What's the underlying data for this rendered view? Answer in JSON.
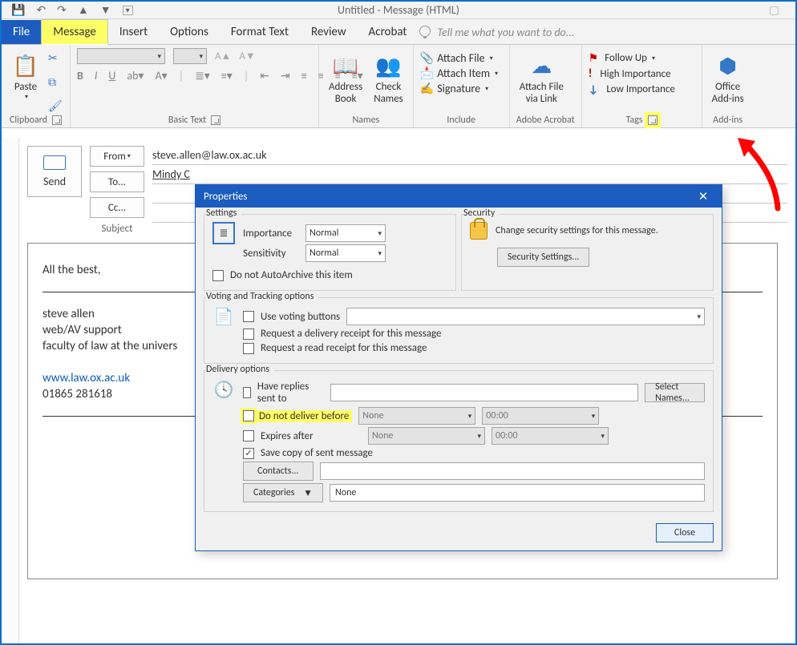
{
  "window": {
    "title": "Untitled - Message (HTML)"
  },
  "qat": {
    "save": "💾",
    "undo": "↶",
    "redo": "↷"
  },
  "tabs": {
    "file": "File",
    "message": "Message",
    "insert": "Insert",
    "options": "Options",
    "format_text": "Format Text",
    "review": "Review",
    "acrobat": "Acrobat",
    "tellme": "Tell me what you want to do..."
  },
  "ribbon": {
    "clipboard": {
      "paste": "Paste",
      "label": "Clipboard"
    },
    "basic_text": {
      "bold": "B",
      "italic": "I",
      "underline": "U",
      "label": "Basic Text"
    },
    "names": {
      "address": "Address",
      "book": "Book",
      "check": "Check",
      "names_line": "Names",
      "label": "Names"
    },
    "include": {
      "attach_file": "Attach File",
      "attach_item": "Attach Item",
      "signature": "Signature",
      "label": "Include"
    },
    "adobe": {
      "line1": "Attach File",
      "line2": "via Link",
      "label": "Adobe Acrobat"
    },
    "tags": {
      "followup": "Follow Up",
      "high": "High Importance",
      "low": "Low Importance",
      "label": "Tags"
    },
    "addins": {
      "line1": "Office",
      "line2": "Add-ins",
      "label": "Add-ins"
    }
  },
  "compose": {
    "from_label": "From",
    "to_label": "To...",
    "cc_label": "Cc...",
    "subject_label": "Subject",
    "send": "Send",
    "from_value": "steve.allen@law.ox.ac.uk",
    "to_value": "Mindy C",
    "body": {
      "l1": "All the best,",
      "l2": "steve allen",
      "l3": "web/AV support",
      "l4": "faculty of law at the univers",
      "l5": "www.law.ox.ac.uk",
      "l6": "01865 281618"
    }
  },
  "dialog": {
    "title": "Properties",
    "settings_legend": "Settings",
    "security_legend": "Security",
    "importance_label": "Importance",
    "importance_value": "Normal",
    "sensitivity_label": "Sensitivity",
    "sensitivity_value": "Normal",
    "autoarchive": "Do not AutoArchive this item",
    "security_text": "Change security settings for this message.",
    "security_btn": "Security Settings...",
    "voting_legend": "Voting and Tracking options",
    "voting": "Use voting buttons",
    "delivery_receipt": "Request a delivery receipt for this message",
    "read_receipt": "Request a read receipt for this message",
    "delivery_legend": "Delivery options",
    "have_replies": "Have replies sent to",
    "select_names": "Select Names...",
    "no_deliver": "Do not deliver before",
    "expires": "Expires after",
    "none": "None",
    "time_zero": "00:00",
    "save_copy": "Save copy of sent message",
    "contacts": "Contacts...",
    "categories": "Categories",
    "categories_value": "None",
    "close": "Close"
  }
}
